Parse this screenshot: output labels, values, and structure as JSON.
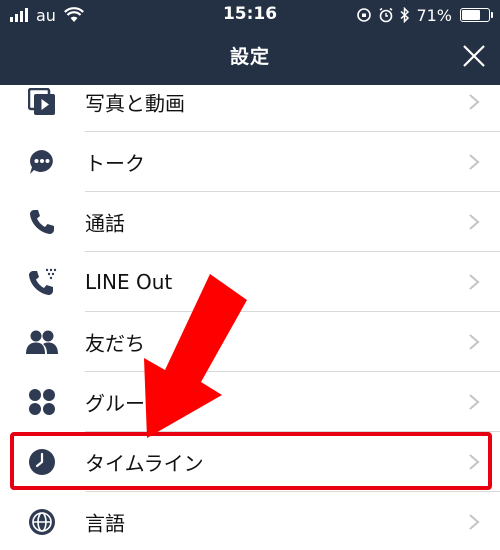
{
  "status_bar": {
    "carrier": "au",
    "time": "15:16",
    "battery_percent": "71%",
    "battery_level": 0.71,
    "icons": [
      "signal-icon",
      "wifi-icon",
      "rotation-lock-icon",
      "alarm-icon",
      "bluetooth-icon",
      "battery-icon"
    ]
  },
  "header": {
    "title": "設定",
    "close_icon": "close-icon"
  },
  "settings": {
    "items": [
      {
        "label": "写真と動画",
        "icon": "photo-video-icon"
      },
      {
        "label": "トーク",
        "icon": "chat-bubble-icon"
      },
      {
        "label": "通話",
        "icon": "phone-icon"
      },
      {
        "label": "LINE Out",
        "icon": "line-out-phone-icon"
      },
      {
        "label": "友だち",
        "icon": "friends-icon"
      },
      {
        "label": "グループ",
        "icon": "groups-icon"
      },
      {
        "label": "タイムライン",
        "icon": "clock-icon"
      },
      {
        "label": "言語",
        "icon": "globe-icon"
      }
    ]
  },
  "annotation": {
    "highlight_color": "#e60012",
    "highlighted_item": "タイムライン",
    "arrow_icon": "red-arrow-icon"
  },
  "colors": {
    "header_bg": "#243043",
    "icon_color": "#2f3b52",
    "chevron": "#c4c4c4"
  }
}
